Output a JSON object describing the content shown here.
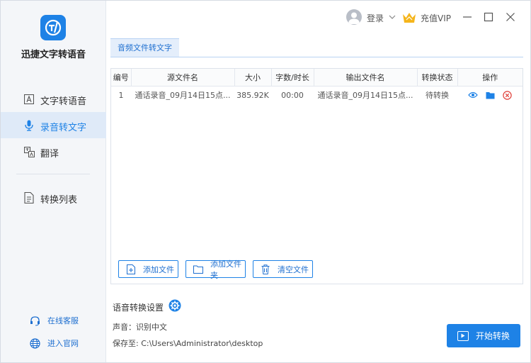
{
  "app": {
    "name": "迅捷文字转语音",
    "logo_icon": "logo-icon"
  },
  "sidebar": {
    "items": [
      {
        "label": "文字转语音",
        "icon": "text-a-icon"
      },
      {
        "label": "录音转文字",
        "icon": "microphone-icon",
        "active": true
      },
      {
        "label": "翻译",
        "icon": "translate-icon"
      },
      {
        "label": "转换列表",
        "icon": "list-doc-icon"
      }
    ],
    "footer": [
      {
        "label": "在线客服",
        "icon": "headset-icon"
      },
      {
        "label": "进入官网",
        "icon": "globe-icon"
      }
    ]
  },
  "titlebar": {
    "login_label": "登录",
    "vip_label": "充值VIP"
  },
  "tab": {
    "label": "音频文件转文字"
  },
  "table": {
    "headers": [
      "编号",
      "源文件名",
      "大小",
      "字数/时长",
      "输出文件名",
      "转换状态",
      "操作"
    ],
    "rows": [
      {
        "index": "1",
        "source": "通话录音_09月14日15点...",
        "size": "385.92K",
        "duration": "00:00",
        "output": "通话录音_09月14日15点...",
        "status": "待转换"
      }
    ]
  },
  "actions": {
    "add_file": "添加文件",
    "add_folder": "添加文件夹",
    "clear_files": "清空文件"
  },
  "settings": {
    "title": "语音转换设置",
    "voice_line": "声音：识别中文",
    "save_line": "保存至: C:\\Users\\Administrator\\desktop",
    "start_label": "开始转换"
  },
  "colors": {
    "accent": "#1e82e6",
    "sidebar_bg": "#f4f6f9",
    "active_bg": "#dfeaf8",
    "delete_red": "#e0403a"
  }
}
